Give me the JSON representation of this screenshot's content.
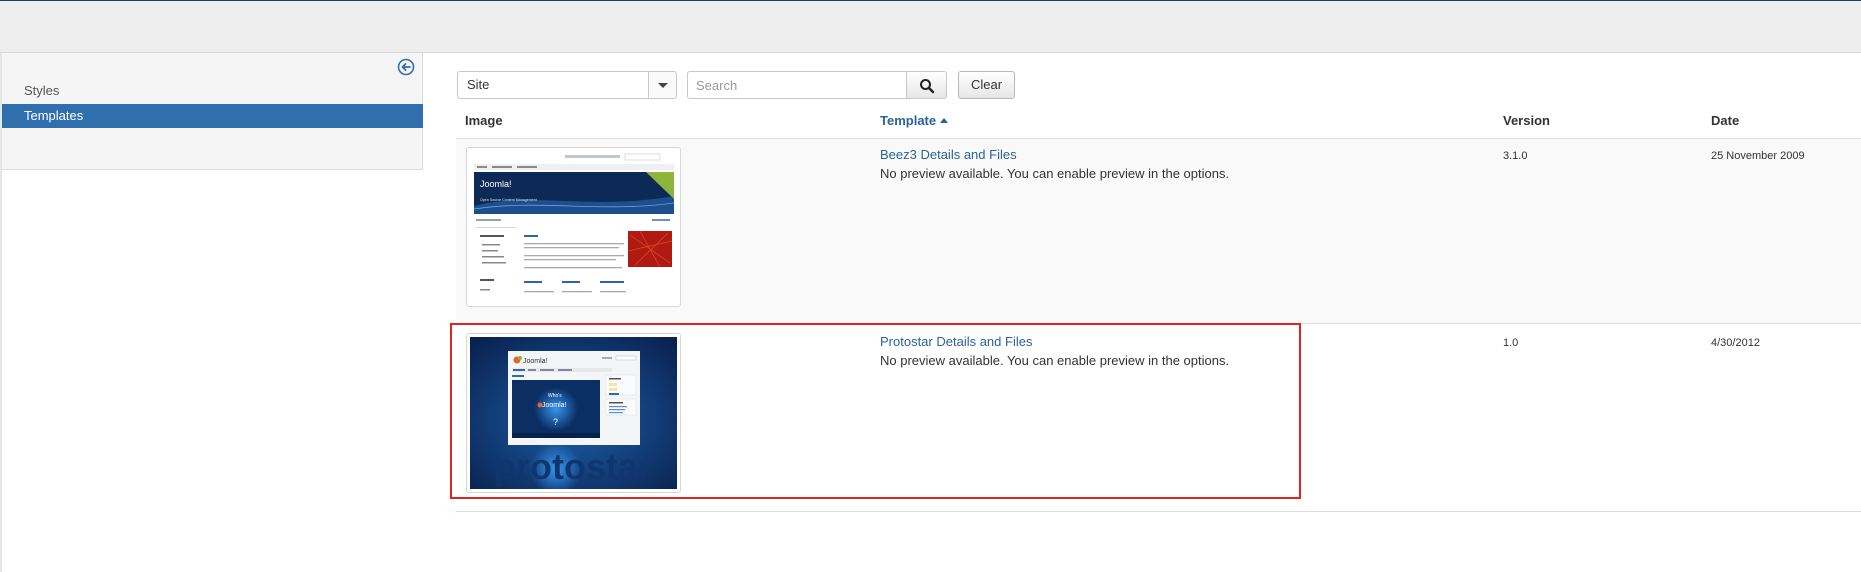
{
  "sidebar": {
    "items": [
      {
        "label": "Styles",
        "active": false
      },
      {
        "label": "Templates",
        "active": true
      }
    ],
    "toggle_icon": "arrow-left-circle-icon"
  },
  "filters": {
    "client_select": {
      "selected": "Site"
    },
    "search": {
      "placeholder": "Search",
      "value": ""
    },
    "clear_label": "Clear"
  },
  "table": {
    "columns": {
      "image": "Image",
      "template": "Template",
      "version": "Version",
      "date": "Date"
    },
    "rows": [
      {
        "name": "Beez3 Details and Files",
        "note": "No preview available. You can enable preview in the options.",
        "version": "3.1.0",
        "date": "25 November 2009",
        "thumbnail": {
          "site_title": "Joomla!",
          "tagline": "Open Source Content Management"
        }
      },
      {
        "name": "Protostar Details and Files",
        "note": "No preview available. You can enable preview in the options.",
        "version": "1.0",
        "date": "4/30/2012",
        "thumbnail": {
          "logo_text": "Joomla!",
          "wordmark": "protostar"
        }
      }
    ]
  },
  "colors": {
    "accent": "#2f6fad",
    "link": "#2a6496",
    "highlight": "#e02424"
  }
}
